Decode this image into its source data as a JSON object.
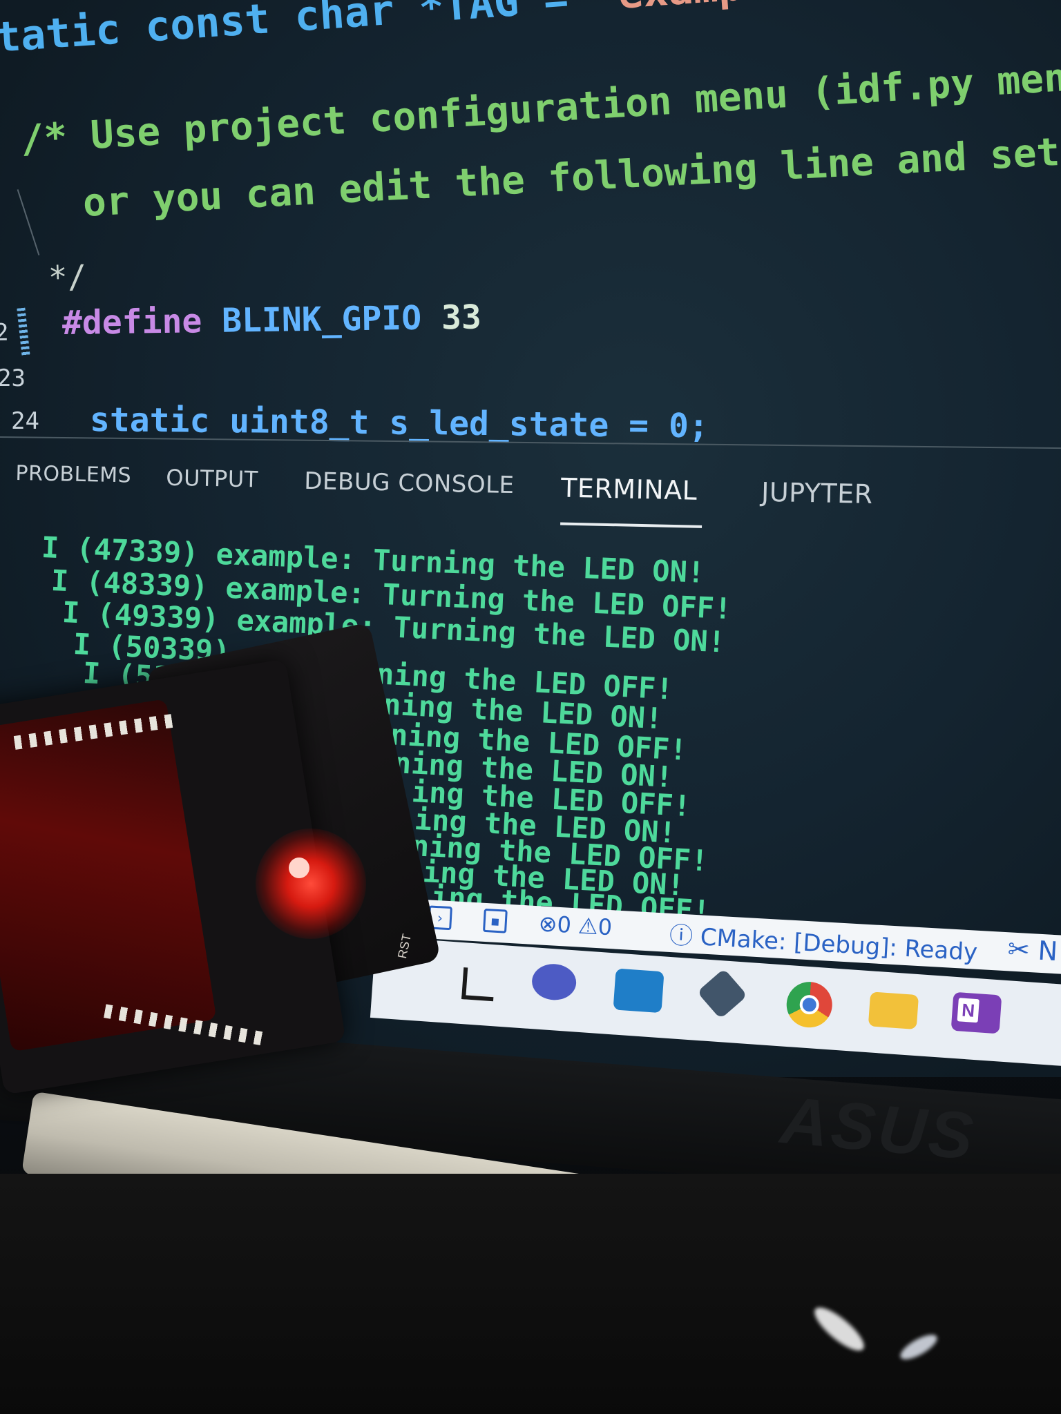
{
  "editor": {
    "code_lines": {
      "tag_keyword": "tatic const char ",
      "tag_var": "*TAG = ",
      "tag_value": "\"example\";",
      "comment1": "/* Use project configuration menu (idf.py menuc",
      "comment2": "or you can edit the following line and set a",
      "comment3": "*/",
      "define_directive": "#define ",
      "define_name": "BLINK_GPIO ",
      "define_value": "33",
      "state_line": "static uint8_t s_led_state = 0;"
    },
    "gutter": {
      "line22": "2",
      "line23": "23",
      "line24": "24"
    }
  },
  "panel": {
    "tabs": {
      "problems": "PROBLEMS",
      "output": "OUTPUT",
      "debug_console": "DEBUG CONSOLE",
      "terminal": "TERMINAL",
      "jupyter": "JUPYTER"
    },
    "active_tab": "TERMINAL"
  },
  "terminal": {
    "lines": [
      "I (47339) example: Turning the LED ON!",
      "I (48339) example: Turning the LED OFF!",
      "I (49339) example: Turning the LED ON!",
      "I (50339) exampl",
      "I (5133",
      "rning the LED OFF!",
      "rning the LED ON!",
      "rning the LED OFF!",
      "ning the LED ON!",
      "ing the LED OFF!",
      "ing the LED ON!",
      "ning the LED OFF!",
      "ing the LED ON!",
      "ing the LED OFF!"
    ]
  },
  "statusbar": {
    "problems_count": "⊗0 ⚠0",
    "cmake_status": "ⓘ CMake: [Debug]: Ready",
    "tools": "✂ N"
  },
  "taskbar": {
    "onenote_letter": "N"
  },
  "hardware": {
    "board_label": "RST",
    "led_color": "#ff3a2a"
  },
  "colors": {
    "terminal_text": "#4ed99b",
    "comment_text": "#7fcf6e",
    "keyword": "#4fb0f0",
    "string": "#e79a86",
    "macro": "#c88ae6"
  }
}
